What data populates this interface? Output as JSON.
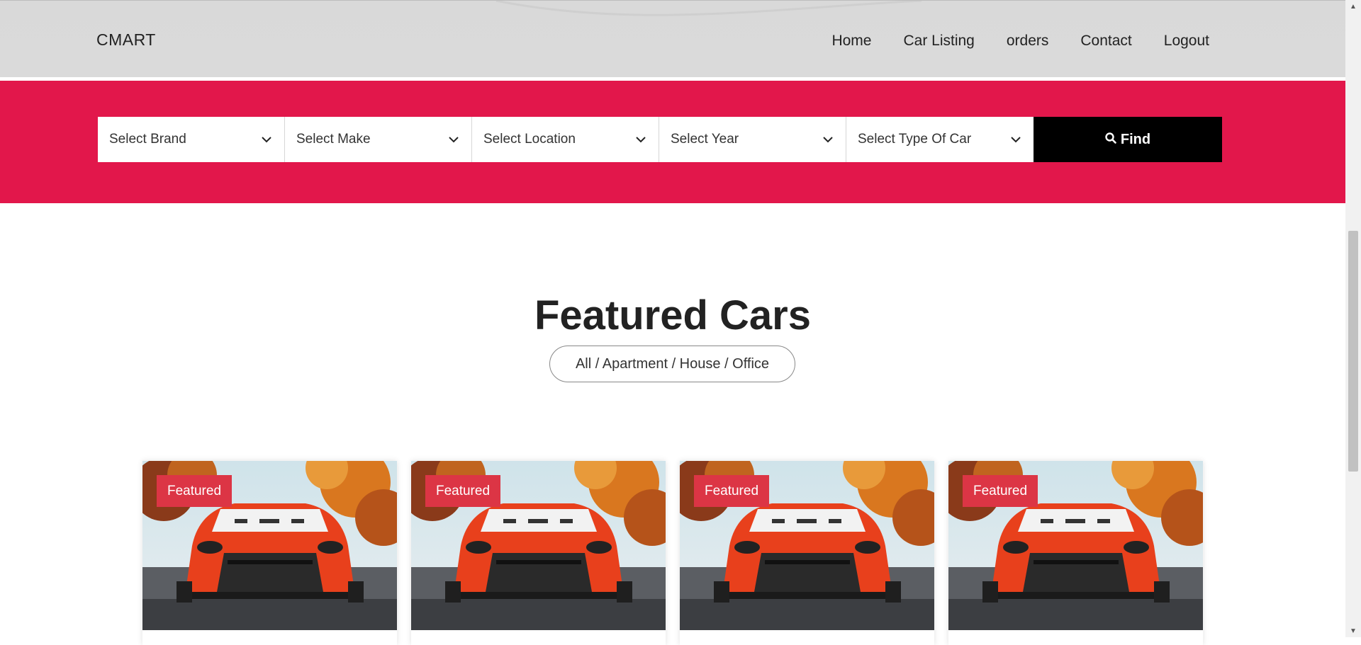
{
  "header": {
    "brand": "CMART",
    "nav": [
      "Home",
      "Car Listing",
      "orders",
      "Contact",
      "Logout"
    ]
  },
  "search": {
    "selects": [
      "Select Brand",
      "Select Make",
      "Select Location",
      "Select Year",
      "Select Type Of Car"
    ],
    "find_label": "Find"
  },
  "featured": {
    "title": "Featured Cars",
    "filter": "All / Apartment / House / Office",
    "cards": [
      {
        "badge": "Featured"
      },
      {
        "badge": "Featured"
      },
      {
        "badge": "Featured"
      },
      {
        "badge": "Featured"
      }
    ]
  },
  "colors": {
    "accent": "#e2174b",
    "badge": "#dc3545",
    "header_bg": "#d9d9d9",
    "car_body": "#e8401c"
  },
  "icons": {
    "find": "search-icon",
    "select": "chevron-down-icon"
  }
}
